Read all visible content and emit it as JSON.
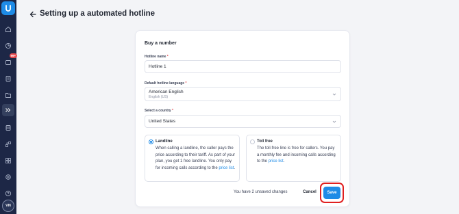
{
  "sidebar": {
    "badge": "99+",
    "avatar_initials": "VN",
    "items": [
      {
        "icon": "home-icon"
      },
      {
        "icon": "chart-icon"
      },
      {
        "icon": "inbox-icon"
      },
      {
        "icon": "clipboard-icon"
      },
      {
        "icon": "folder-icon"
      },
      {
        "icon": "routing-icon"
      },
      {
        "icon": "database-icon"
      },
      {
        "icon": "flow-icon"
      },
      {
        "icon": "integrations-icon"
      },
      {
        "icon": "settings-icon"
      },
      {
        "icon": "help-icon"
      }
    ]
  },
  "header": {
    "title": "Setting up a automated hotline"
  },
  "form": {
    "section_title": "Buy a number",
    "hotline_name": {
      "label": "Hotline name",
      "required_mark": "*",
      "value": "Hotline 1"
    },
    "language": {
      "label": "Default hotline language",
      "required_mark": "*",
      "value": "American English",
      "sub": "English (US)"
    },
    "country": {
      "label": "Select a country",
      "required_mark": "*",
      "value": "United States"
    },
    "options": [
      {
        "title": "Landline",
        "checked": true,
        "desc": "When calling a landline, the caller pays the price according to their tariff. As part of your plan, you get 1 free landline. You only pay for incoming calls according to the ",
        "link": "price list",
        "end": "."
      },
      {
        "title": "Toll free",
        "checked": false,
        "desc": "The toll-free line is free for callers. You pay a monthly fee and incoming calls according to the ",
        "link": "price list",
        "end": "."
      }
    ],
    "unsaved_text": "You have 2 unsaved changes",
    "cancel_label": "Cancel",
    "save_label": "Save"
  },
  "colors": {
    "accent": "#1e8be6",
    "sidebar": "#1d2746",
    "highlight": "#e02020"
  }
}
